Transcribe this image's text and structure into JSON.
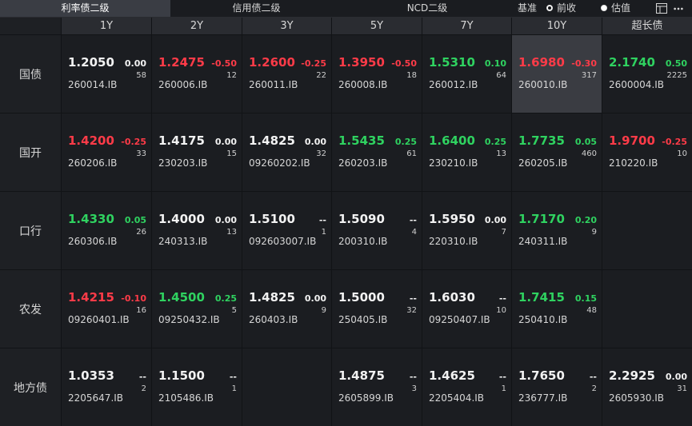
{
  "tabs": [
    {
      "label": "利率债二级",
      "active": true
    },
    {
      "label": "信用债二级",
      "active": false
    },
    {
      "label": "NCD二级",
      "active": false
    }
  ],
  "basis": {
    "label": "基准",
    "options": [
      {
        "label": "前收",
        "selected": true
      },
      {
        "label": "估值",
        "selected": false
      }
    ]
  },
  "toolbar_icons": [
    "layout-icon",
    "more-icon"
  ],
  "columns": [
    "1Y",
    "2Y",
    "3Y",
    "5Y",
    "7Y",
    "10Y",
    "超长债"
  ],
  "colors": {
    "up": "#ff3b48",
    "down": "#2fd260",
    "flat": "#f2f2f2"
  },
  "rows": [
    {
      "label": "国债",
      "cells": [
        {
          "yield": "1.2050",
          "change": "0.00",
          "volume": "58",
          "code": "260014.IB",
          "dir": "flat"
        },
        {
          "yield": "1.2475",
          "change": "-0.50",
          "volume": "12",
          "code": "260006.IB",
          "dir": "up"
        },
        {
          "yield": "1.2600",
          "change": "-0.25",
          "volume": "22",
          "code": "260011.IB",
          "dir": "up"
        },
        {
          "yield": "1.3950",
          "change": "-0.50",
          "volume": "18",
          "code": "260008.IB",
          "dir": "up"
        },
        {
          "yield": "1.5310",
          "change": "0.10",
          "volume": "64",
          "code": "260012.IB",
          "dir": "down"
        },
        {
          "yield": "1.6980",
          "change": "-0.30",
          "volume": "317",
          "code": "260010.IB",
          "dir": "up",
          "highlight": true
        },
        {
          "yield": "2.1740",
          "change": "0.50",
          "volume": "2225",
          "code": "2600004.IB",
          "dir": "down"
        }
      ]
    },
    {
      "label": "国开",
      "cells": [
        {
          "yield": "1.4200",
          "change": "-0.25",
          "volume": "33",
          "code": "260206.IB",
          "dir": "up"
        },
        {
          "yield": "1.4175",
          "change": "0.00",
          "volume": "15",
          "code": "230203.IB",
          "dir": "flat"
        },
        {
          "yield": "1.4825",
          "change": "0.00",
          "volume": "32",
          "code": "09260202.IB",
          "dir": "flat"
        },
        {
          "yield": "1.5435",
          "change": "0.25",
          "volume": "61",
          "code": "260203.IB",
          "dir": "down"
        },
        {
          "yield": "1.6400",
          "change": "0.25",
          "volume": "13",
          "code": "230210.IB",
          "dir": "down"
        },
        {
          "yield": "1.7735",
          "change": "0.05",
          "volume": "460",
          "code": "260205.IB",
          "dir": "down"
        },
        {
          "yield": "1.9700",
          "change": "-0.25",
          "volume": "10",
          "code": "210220.IB",
          "dir": "up"
        }
      ]
    },
    {
      "label": "口行",
      "cells": [
        {
          "yield": "1.4330",
          "change": "0.05",
          "volume": "26",
          "code": "260306.IB",
          "dir": "down"
        },
        {
          "yield": "1.4000",
          "change": "0.00",
          "volume": "13",
          "code": "240313.IB",
          "dir": "flat"
        },
        {
          "yield": "1.5100",
          "change": "--",
          "volume": "1",
          "code": "092603007.IB",
          "dir": "flat"
        },
        {
          "yield": "1.5090",
          "change": "--",
          "volume": "4",
          "code": "200310.IB",
          "dir": "flat"
        },
        {
          "yield": "1.5950",
          "change": "0.00",
          "volume": "7",
          "code": "220310.IB",
          "dir": "flat"
        },
        {
          "yield": "1.7170",
          "change": "0.20",
          "volume": "9",
          "code": "240311.IB",
          "dir": "down"
        },
        null
      ]
    },
    {
      "label": "农发",
      "cells": [
        {
          "yield": "1.4215",
          "change": "-0.10",
          "volume": "16",
          "code": "09260401.IB",
          "dir": "up"
        },
        {
          "yield": "1.4500",
          "change": "0.25",
          "volume": "5",
          "code": "09250432.IB",
          "dir": "down"
        },
        {
          "yield": "1.4825",
          "change": "0.00",
          "volume": "9",
          "code": "260403.IB",
          "dir": "flat"
        },
        {
          "yield": "1.5000",
          "change": "--",
          "volume": "32",
          "code": "250405.IB",
          "dir": "flat"
        },
        {
          "yield": "1.6030",
          "change": "--",
          "volume": "10",
          "code": "09250407.IB",
          "dir": "flat"
        },
        {
          "yield": "1.7415",
          "change": "0.15",
          "volume": "48",
          "code": "250410.IB",
          "dir": "down"
        },
        null
      ]
    },
    {
      "label": "地方债",
      "cells": [
        {
          "yield": "1.0353",
          "change": "--",
          "volume": "2",
          "code": "2205647.IB",
          "dir": "flat"
        },
        {
          "yield": "1.1500",
          "change": "--",
          "volume": "1",
          "code": "2105486.IB",
          "dir": "flat"
        },
        null,
        {
          "yield": "1.4875",
          "change": "--",
          "volume": "3",
          "code": "2605899.IB",
          "dir": "flat"
        },
        {
          "yield": "1.4625",
          "change": "--",
          "volume": "1",
          "code": "2205404.IB",
          "dir": "flat"
        },
        {
          "yield": "1.7650",
          "change": "--",
          "volume": "2",
          "code": "236777.IB",
          "dir": "flat"
        },
        {
          "yield": "2.2925",
          "change": "0.00",
          "volume": "31",
          "code": "2605930.IB",
          "dir": "flat"
        }
      ]
    }
  ]
}
